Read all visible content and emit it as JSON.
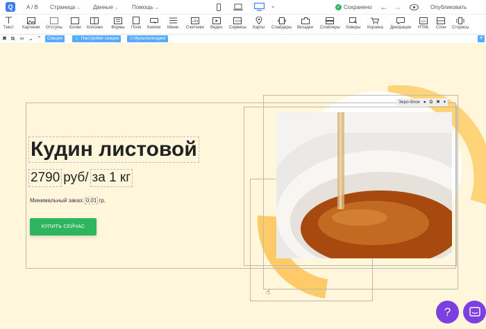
{
  "topbar": {
    "logo": "Q",
    "page_id": "A / B",
    "menus": [
      {
        "label": "Страница"
      },
      {
        "label": "Данные"
      },
      {
        "label": "Помощь"
      }
    ],
    "save_status": "Сохранено",
    "publish_label": "Опубликовать"
  },
  "toolbar": {
    "tools": [
      {
        "label": "Текст",
        "icon": "text-icon"
      },
      {
        "label": "Картинки",
        "icon": "image-icon"
      },
      {
        "label": "Отступы",
        "icon": "spacing-icon"
      },
      {
        "label": "Блоки",
        "icon": "blocks-icon"
      },
      {
        "label": "Колонки",
        "icon": "columns-icon"
      },
      {
        "label": "Формы",
        "icon": "forms-icon"
      },
      {
        "label": "Поля",
        "icon": "fields-icon"
      },
      {
        "label": "Кнопки",
        "icon": "buttons-icon"
      },
      {
        "label": "Меню",
        "icon": "menu-icon"
      },
      {
        "label": "Счетчики",
        "icon": "counters-icon"
      },
      {
        "label": "Видео",
        "icon": "video-icon"
      },
      {
        "label": "Сервисы",
        "icon": "services-icon"
      },
      {
        "label": "Карты",
        "icon": "map-icon"
      },
      {
        "label": "Слайдеры",
        "icon": "sliders-icon"
      },
      {
        "label": "Вкладки",
        "icon": "tabs-icon"
      },
      {
        "label": "Спойлеры",
        "icon": "spoilers-icon"
      },
      {
        "label": "Ховеры",
        "icon": "hovers-icon"
      },
      {
        "label": "Корзина",
        "icon": "cart-icon"
      },
      {
        "label": "Декорации",
        "icon": "decorations-icon"
      },
      {
        "label": "HTML",
        "icon": "html-icon"
      },
      {
        "label": "Слои",
        "icon": "layers-icon"
      },
      {
        "label": "Сторисы",
        "icon": "stories-icon"
      }
    ]
  },
  "sectionbar": {
    "section_label": "Секция",
    "settings_label": "Настройки секции",
    "multilanding_label": "Мультилендинг"
  },
  "content": {
    "title": "Кудин листовой",
    "price_value": "2790",
    "price_unit": "руб/",
    "price_per": "за 1 кг",
    "min_order_label": "Минимальный заказ:",
    "min_order_value": "0.01",
    "min_order_unit": "гр.",
    "buy_label": "КУПИТЬ СЕЙЧАС",
    "zero_block_label": "Зеро-блок"
  },
  "help_label": "?",
  "colors": {
    "accent": "#55aaff",
    "green": "#2fb55d",
    "purple": "#7e3fe0",
    "canvas_bg": "#fff6dc",
    "orange": "#ffc55a"
  }
}
